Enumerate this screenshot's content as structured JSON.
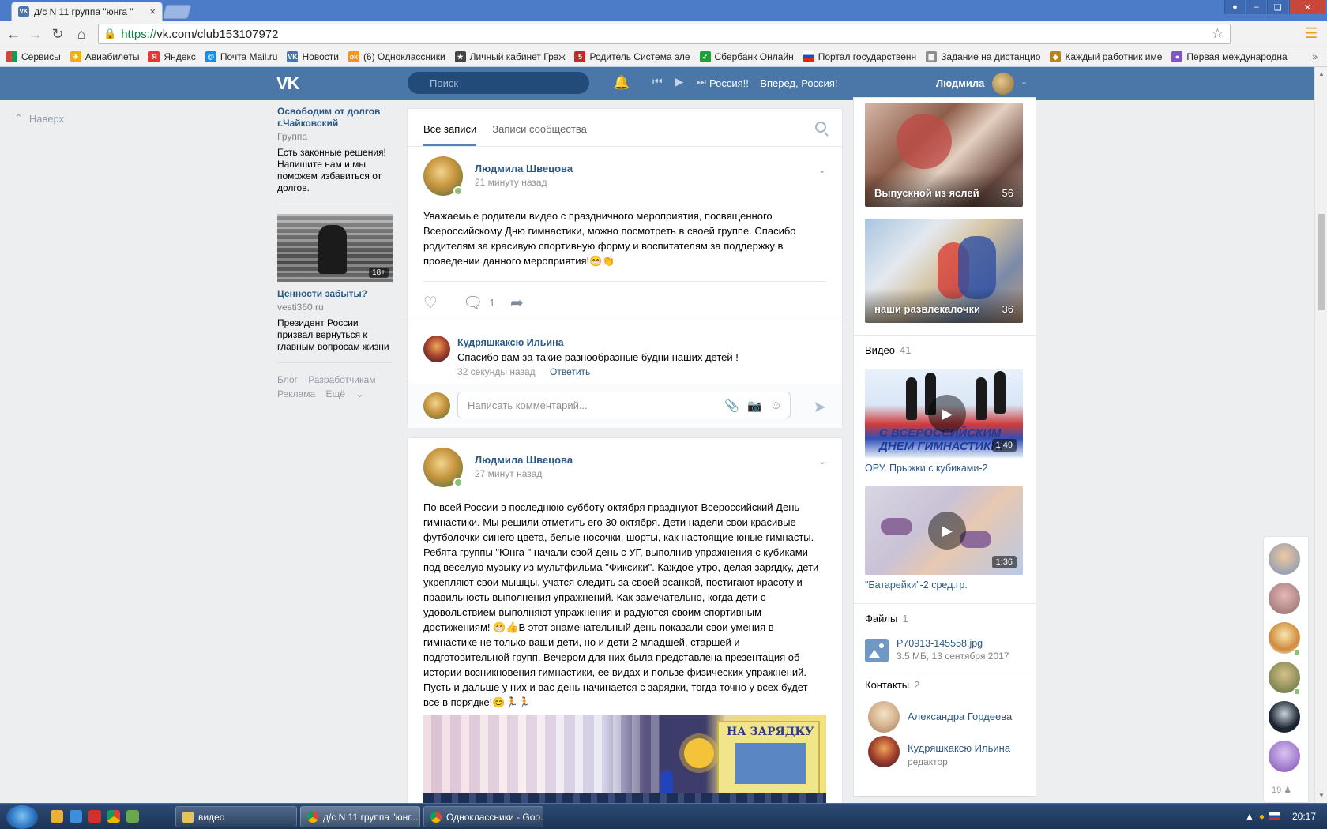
{
  "browser": {
    "tab_title": "д/с N 11 группа \"юнга \"",
    "tab_close": "×",
    "url_scheme": "https://",
    "url_rest": "vk.com/club153107972",
    "bookmarks": [
      "Сервисы",
      "Авиабилеты",
      "Яндекс",
      "Почта Mail.ru",
      "Новости",
      "(6) Одноклассники",
      "Личный кабинет Граж",
      "Родитель Система эле",
      "Сбербанк Онлайн",
      "Портал государственн",
      "Задание на дистанцио",
      "Каждый работник име",
      "Первая международна"
    ]
  },
  "vk_header": {
    "logo": "VK",
    "search_placeholder": "Поиск",
    "now_playing": "Россия!! – Вперед, Россия!",
    "user_name": "Людмила"
  },
  "left": {
    "naverh": "Наверх",
    "ad1": {
      "title": "Освободим от долгов г.Чайковский",
      "type": "Группа",
      "text": "Есть законные решения! Напишите нам и мы поможем избавиться от долгов."
    },
    "ad2": {
      "badge": "18+",
      "title": "Ценности забыты?",
      "domain": "vesti360.ru",
      "text": "Президент России призвал вернуться к главным вопросам жизни"
    },
    "footer": {
      "blog": "Блог",
      "dev": "Разработчикам",
      "ads": "Реклама",
      "more": "Ещё"
    }
  },
  "feed": {
    "tabs": [
      "Все записи",
      "Записи сообщества"
    ],
    "post1": {
      "author": "Людмила Швецова",
      "time": "21 минуту назад",
      "text": "Уважаемые родители видео с праздничного мероприятия, посвященного Всероссийскому Дню гимнастики, можно посмотреть в своей группе. Спасибо родителям за красивую спортивную форму и воспитателям за поддержку в проведении данного мероприятия!😁👏",
      "comments_count": "1"
    },
    "comment": {
      "author": "Кудряшкаксю Ильина",
      "text": "Спасибо вам за такие разнообразные будни наших детей !",
      "time": "32 секунды назад",
      "reply": "Ответить"
    },
    "reply_placeholder": "Написать комментарий...",
    "post2": {
      "author": "Людмила Швецова",
      "time": "27 минут назад",
      "text": "По всей России в последнюю субботу октября празднуют Всероссийский День гимнастики. Мы решили отметить его 30 октября. Дети надели свои красивые футболочки синего цвета, белые носочки, шорты, как настоящие юные гимнасты. Ребята группы \"Юнга \" начали свой день с УГ, выполнив упражнения с кубиками под веселую музыку из мультфильма \"Фиксики\". Каждое утро, делая зарядку, дети укрепляют свои мышцы, учатся следить за своей осанкой, постигают красоту и правильность выполнения упражнений. Как замечательно, когда дети с удовольствием выполняют упражнения и радуются своим спортивным достижениям! 😁👍В этот знаменательный день показали свои умения в гимнастике не только ваши дети, но и дети 2 младшей, старшей и подготовительной групп. Вечером для них была представлена презентация об истории возникновения гимнастики, ее видах и пользе физических упражнений. Пусть и дальше у них и вас день начинается с зарядки, тогда точно у всех будет все в порядке!😊🏃🏃",
      "photo_sign": "НА ЗАРЯДКУ"
    }
  },
  "right": {
    "albums": [
      {
        "title": "Выпускной из яслей",
        "count": "56"
      },
      {
        "title": "наши развлекалочки",
        "count": "36"
      }
    ],
    "videos_label": "Видео",
    "videos_count": "41",
    "videos": [
      {
        "title": "ОРУ. Прыжки с кубиками-2",
        "duration": "1:49",
        "caption": "С ВСЕРОССИЙСКИМ ДНЕМ ГИМНАСТИКИ!"
      },
      {
        "title": "\"Батарейки\"-2 сред.гр.",
        "duration": "1:36"
      }
    ],
    "files_label": "Файлы",
    "files_count": "1",
    "file": {
      "name": "P70913-145558.jpg",
      "meta": "3.5 МБ, 13 сентября 2017"
    },
    "contacts_label": "Контакты",
    "contacts_count": "2",
    "contacts": [
      {
        "name": "Александра Гордеева",
        "role": ""
      },
      {
        "name": "Кудряшкаксю Ильина",
        "role": "редактор"
      }
    ]
  },
  "friends_count": "19",
  "taskbar": {
    "tasks": [
      "видео",
      "д/с N 11 группа \"юнг...",
      "Одноклассники - Goo..."
    ],
    "time": "20:17"
  },
  "colors": {
    "vk_blue": "#4a76a8",
    "link": "#2a5885",
    "background": "#edeef0"
  }
}
